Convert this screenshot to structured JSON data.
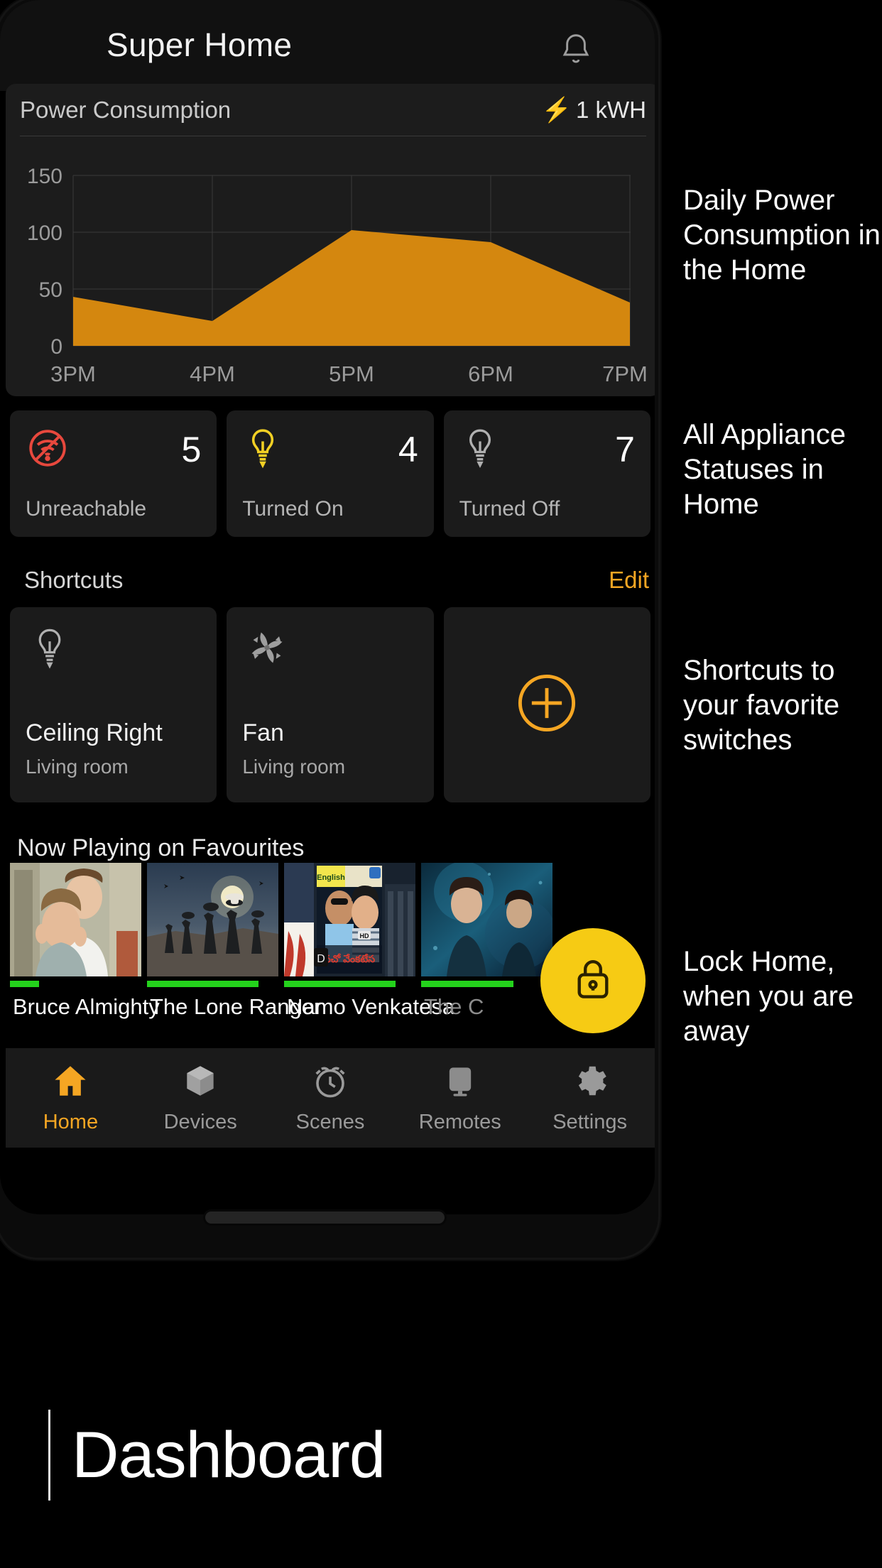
{
  "app": {
    "title": "Super Home",
    "notification_icon": "bell-icon"
  },
  "power_card": {
    "title": "Power Consumption",
    "value": "1 kWH",
    "bolt_icon": "lightning-bolt-icon"
  },
  "chart_data": {
    "type": "area",
    "title": "Power Consumption",
    "categories": [
      "3PM",
      "4PM",
      "5PM",
      "6PM",
      "7PM"
    ],
    "values": [
      43,
      22,
      102,
      91,
      38
    ],
    "xlabel": "",
    "ylabel": "",
    "ylim": [
      0,
      150
    ],
    "yticks": [
      0,
      50,
      100,
      150
    ],
    "ytick_labels": [
      "0",
      "50",
      "100",
      "150"
    ],
    "grid": true,
    "legend": "none",
    "fill_color": "#D4870F",
    "grid_color": "#3a3a3a"
  },
  "status_cards": [
    {
      "icon": "wifi-off-icon",
      "count": "5",
      "label": "Unreachable",
      "color": "#E8483D"
    },
    {
      "icon": "bulb-on-icon",
      "count": "4",
      "label": "Turned On",
      "color": "#F2D024"
    },
    {
      "icon": "bulb-off-icon",
      "count": "7",
      "label": "Turned Off",
      "color": "#9b9b9b"
    }
  ],
  "shortcuts": {
    "title": "Shortcuts",
    "edit_label": "Edit",
    "items": [
      {
        "icon": "bulb-off-icon",
        "name": "Ceiling Right",
        "room": "Living room"
      },
      {
        "icon": "fan-icon",
        "name": "Fan",
        "room": "Living room"
      }
    ],
    "add_icon": "plus-circle-icon",
    "add_color": "#F5A623"
  },
  "now_playing": {
    "title": "Now Playing on Favourites",
    "items": [
      {
        "title": "Bruce Almighty",
        "progress": 22
      },
      {
        "title": "The Lone Ranger",
        "progress": 85
      },
      {
        "title": "Namo Venkatesa",
        "progress": 85
      },
      {
        "title": "The C",
        "progress": 70
      }
    ]
  },
  "lock_fab": {
    "icon": "lock-icon",
    "color": "#F6CB14"
  },
  "bottom_nav": {
    "items": [
      {
        "icon": "home-icon",
        "label": "Home",
        "active": true
      },
      {
        "icon": "devices-cube-icon",
        "label": "Devices",
        "active": false
      },
      {
        "icon": "scenes-clock-icon",
        "label": "Scenes",
        "active": false
      },
      {
        "icon": "remotes-monitor-icon",
        "label": "Remotes",
        "active": false
      },
      {
        "icon": "settings-gear-icon",
        "label": "Settings",
        "active": false
      }
    ],
    "active_color": "#F5A623"
  },
  "annotations": [
    "Daily Power Consumption in the Home",
    "All Appliance Statuses in Home",
    "Shortcuts to your favorite switches",
    "Lock Home, when you are away"
  ],
  "footer": {
    "caption": "Dashboard"
  }
}
